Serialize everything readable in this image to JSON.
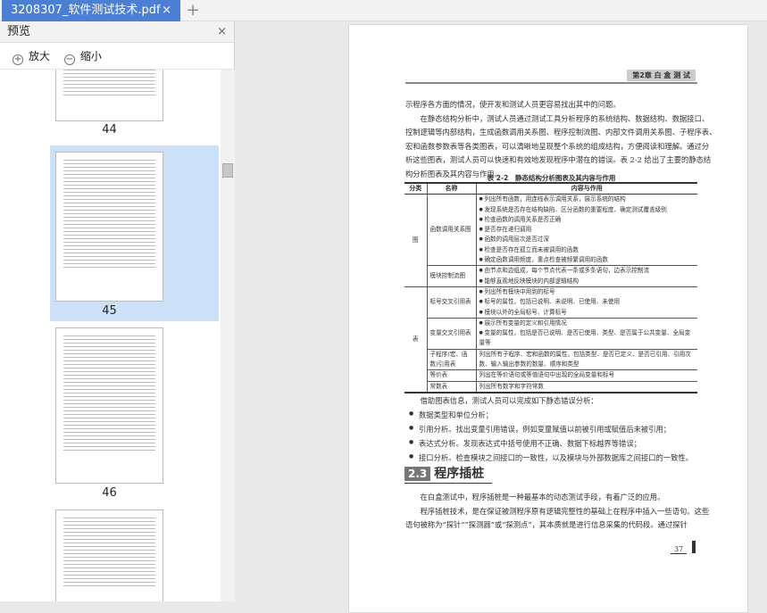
{
  "tab": {
    "title": "3208307_软件测试技术.pdf",
    "close": "×",
    "new_tab": "+"
  },
  "sidebar": {
    "title": "预览",
    "close": "×",
    "zoom_in": "放大",
    "zoom_out": "缩小",
    "thumbnails": [
      {
        "page": "44"
      },
      {
        "page": "45"
      },
      {
        "page": "46"
      }
    ]
  },
  "page": {
    "header": "第2章  白 盒 测 试",
    "paras": [
      "示程序各方面的情况，使开发和测试人员更容易找出其中的问题。",
      "　　在静态结构分析中，测试人员通过测试工具分析程序的系统结构、数据结构、数据接口、",
      "控制逻辑等内部结构，生成函数调用关系图、程序控制流图、内部文件调用关系图、子程序表、",
      "宏和函数参数表等各类图表，可以清晰地呈现整个系统的组成结构，方便阅读和理解。通过分",
      "析这些图表，测试人员可以快速和有效地发现程序中潜在的错误。表 2-2 给出了主要的静态结",
      "构分析图表及其内容与作用。"
    ],
    "table": {
      "caption": "表 2-2　静态结构分析图表及其内容与作用",
      "headers": [
        "分类",
        "名称",
        "内容与作用"
      ],
      "cat1": "图",
      "cat2": "表",
      "r1": {
        "name": "函数调用关系图",
        "items": [
          "列出所有函数，用连线表示调用关系，展示系统的结构",
          "发现系统是否存在结构缺陷、区分函数的重要程度、确定测试覆盖级别",
          "检查函数的调用关系是否正确",
          "是否存在递归调用",
          "函数的调用层次是否过深",
          "检查是否存在孤立而未被调用的函数",
          "确定函数调用频度，重点检查被频繁调用的函数"
        ]
      },
      "r2": {
        "name": "模块控制流图",
        "items": [
          "由节点和边组成，每个节点代表一条或多条语句，边表示控制流",
          "能够直观地反映模块的内部逻辑结构"
        ]
      },
      "r3": {
        "name": "标号交叉引用表",
        "items": [
          "列出所有模块中用到的标号",
          "标号的属性，包括已说明、未说明、已使用、未使用",
          "模块以外的全局标号、计算标号"
        ]
      },
      "r4": {
        "name": "变量交叉引用表",
        "items": [
          "展示所有变量的定义和引用情况",
          "变量的属性，包括是否已说明、是否已使用、类型、是否属于公共变量、全局变量等"
        ]
      },
      "r5": {
        "name": "子程序(宏、函数)引用表",
        "text": "列出所有子程序、宏和函数的属性，包括类型、是否已定义、是否已引用、引用次数、输入输出参数的数量、顺序和类型"
      },
      "r6": {
        "name": "等价表",
        "text": "列出在等价语句或等值语句中出现的全局变量和标号"
      },
      "r7": {
        "name": "常数表",
        "text": "列出所有数字和字符常数"
      }
    },
    "after": "　　借助图表信息，测试人员可以完成如下静态错误分析：",
    "bullets": [
      "数据类型和单位分析；",
      "引用分析。找出变量引用错误，例如变量赋值以前被引用或赋值后未被引用；",
      "表达式分析。发现表达式中括号使用不正确、数据下标越界等错误；",
      "接口分析。检查模块之间接口的一致性，以及模块与外部数据库之间接口的一致性。"
    ],
    "section": {
      "num": "2.3",
      "title": "程序插桩"
    },
    "paras2": [
      "　　在白盒测试中，程序插桩是一种最基本的动态测试手段，有着广泛的应用。",
      "　　程序插桩技术，是在保证被测程序原有逻辑完整性的基础上在程序中插入一些语句。这些",
      "语句被称为“探针”“探测器”或“探测点”，其本质就是进行信息采集的代码段。通过探针"
    ],
    "page_number": "37"
  }
}
